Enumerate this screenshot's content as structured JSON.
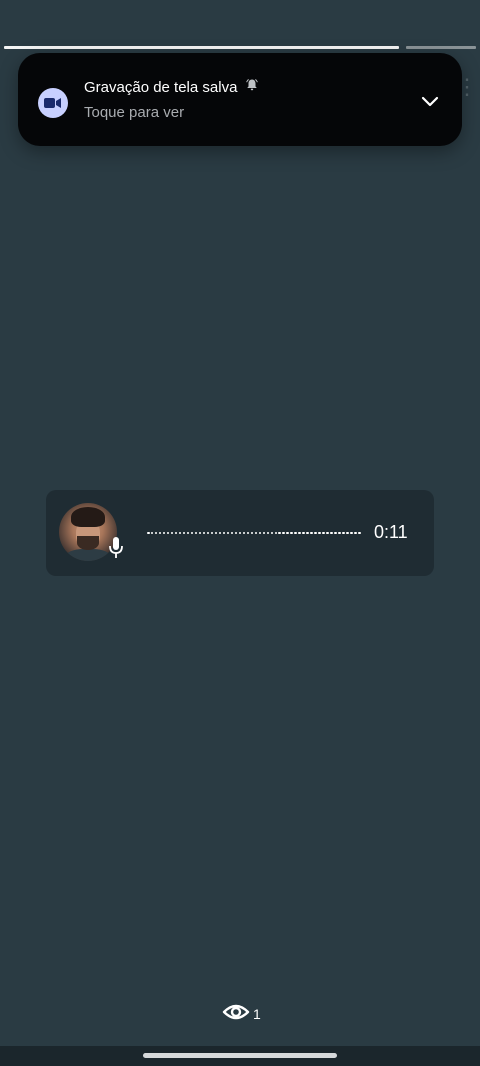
{
  "notification": {
    "title": "Gravação de tela salva",
    "subtitle": "Toque para ver",
    "icon": "video-camera-icon",
    "alert_icon": "bell-alert-icon",
    "expand_icon": "chevron-down-icon",
    "icon_bg_color": "#c8d0ff"
  },
  "story": {
    "progress_segments": 2,
    "current_segment": 1
  },
  "audio_message": {
    "duration": "0:11",
    "avatar_icon": "avatar",
    "mic_icon": "microphone-icon"
  },
  "viewers": {
    "icon": "eye-icon",
    "count": "1"
  },
  "colors": {
    "background": "#2a3b43",
    "card": "#1f2c33",
    "notification_bg": "#050608"
  }
}
